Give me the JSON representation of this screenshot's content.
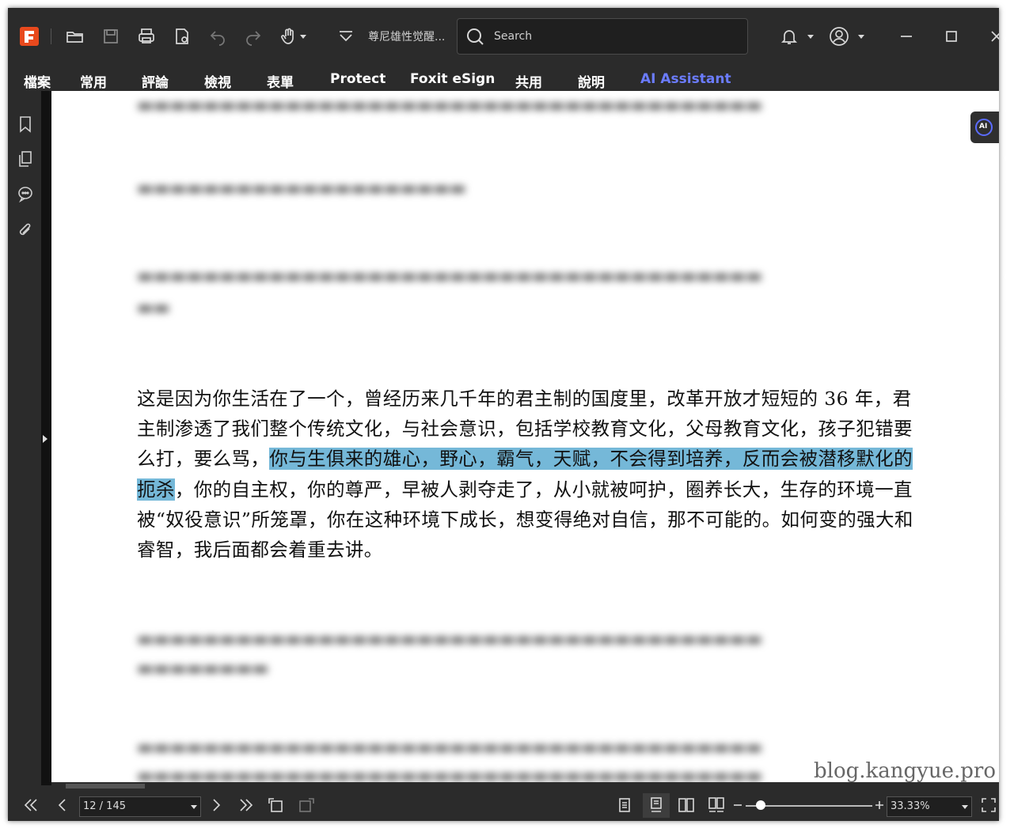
{
  "titlebar": {
    "document_name": "尊尼雄性觉醒...",
    "search_placeholder": "Search"
  },
  "ribbon": {
    "tabs": [
      "檔案",
      "常用",
      "評論",
      "檢視",
      "表單",
      "Protect",
      "Foxit eSign",
      "共用",
      "說明",
      "AI Assistant"
    ]
  },
  "ai_button": {
    "label": "AI"
  },
  "document": {
    "paragraph_before": "这是因为你生活在了一个，曾经历来几千年的君主制的国度里，改革开放才短短的 36 年，君主制渗透了我们整个传统文化，与社会意识，包括学校教育文化，父母教育文化，孩子犯错要么打，要么骂，",
    "highlighted": "你与生俱来的雄心，野心，霸气，天赋，不会得到培养，反而会被潜移默化的扼杀",
    "paragraph_after": "，你的自主权，你的尊严，早被人剥夺走了，从小就被呵护，圈养长大，生存的环境一直被“奴役意识”所笼罩，你在这种环境下成长，想变得绝对自信，那不可能的。如何变的强大和睿智，我后面都会着重去讲。",
    "highlight_color": "#75b8d8"
  },
  "watermark": "blog.kangyue.pro",
  "statusbar": {
    "page_indicator": "12 / 145",
    "zoom": "33.33%",
    "zoom_level_fraction": 0.12
  },
  "colors": {
    "chrome_bg": "#2b2b2b",
    "brand": "#e8491d",
    "ai_accent": "#6b7cff"
  }
}
